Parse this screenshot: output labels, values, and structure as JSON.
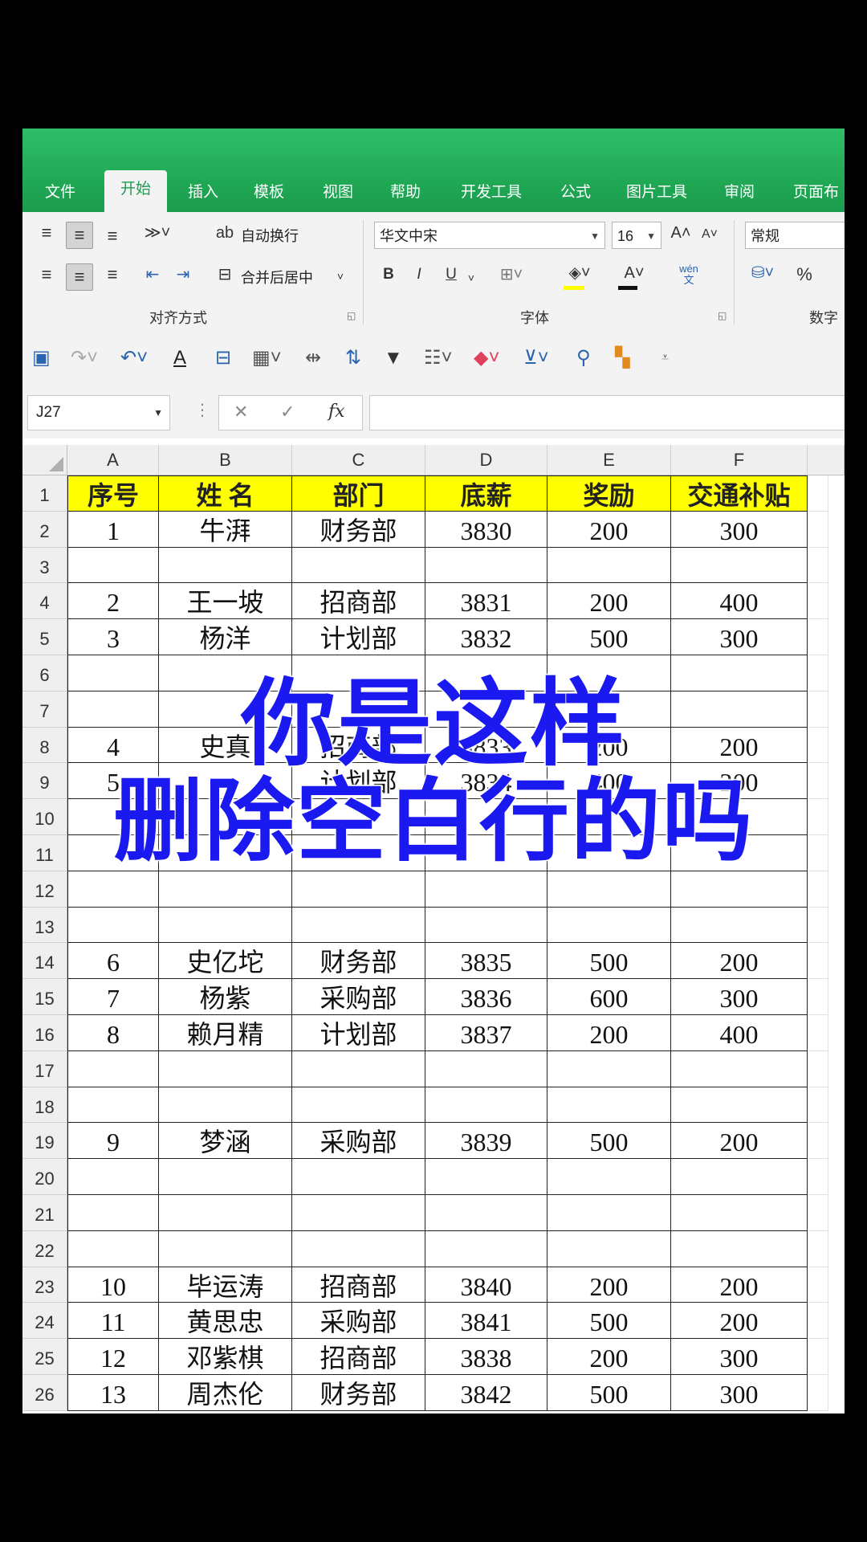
{
  "ribbon_tabs": [
    "文件",
    "开始",
    "插入",
    "模板",
    "视图",
    "帮助",
    "开发工具",
    "公式",
    "图片工具",
    "审阅",
    "页面布"
  ],
  "active_tab": "开始",
  "ribbon": {
    "wrap_text": "自动换行",
    "merge_center": "合并后居中",
    "align_group_label": "对齐方式",
    "font_name": "华文中宋",
    "font_size": "16",
    "font_group_label": "字体",
    "number_format": "常规",
    "number_group_label": "数字",
    "bold": "B",
    "italic": "I",
    "underline": "U",
    "percent": "%",
    "phonetic": "wén"
  },
  "name_box": "J27",
  "formula_value": "",
  "columns": [
    "A",
    "B",
    "C",
    "D",
    "E",
    "F"
  ],
  "header_row": [
    "序号",
    "姓  名",
    "部门",
    "底薪",
    "奖励",
    "交通补贴"
  ],
  "rows": [
    {
      "num": "1",
      "cells": [
        "序号",
        "姓  名",
        "部门",
        "底薪",
        "奖励",
        "交通补贴"
      ]
    },
    {
      "num": "2",
      "cells": [
        "1",
        "牛湃",
        "财务部",
        "3830",
        "200",
        "300"
      ]
    },
    {
      "num": "3",
      "cells": [
        "",
        "",
        "",
        "",
        "",
        ""
      ]
    },
    {
      "num": "4",
      "cells": [
        "2",
        "王一坡",
        "招商部",
        "3831",
        "200",
        "400"
      ]
    },
    {
      "num": "5",
      "cells": [
        "3",
        "杨洋",
        "计划部",
        "3832",
        "500",
        "300"
      ]
    },
    {
      "num": "6",
      "cells": [
        "",
        "",
        "",
        "",
        "",
        ""
      ]
    },
    {
      "num": "7",
      "cells": [
        "",
        "",
        "",
        "",
        "",
        ""
      ]
    },
    {
      "num": "8",
      "cells": [
        "4",
        "史真",
        "招商部",
        "3833",
        "200",
        "200"
      ]
    },
    {
      "num": "9",
      "cells": [
        "5",
        "",
        "计划部",
        "3834",
        "400",
        "200"
      ]
    },
    {
      "num": "10",
      "cells": [
        "",
        "",
        "",
        "",
        "",
        ""
      ]
    },
    {
      "num": "11",
      "cells": [
        "",
        "",
        "",
        "",
        "",
        ""
      ]
    },
    {
      "num": "12",
      "cells": [
        "",
        "",
        "",
        "",
        "",
        ""
      ]
    },
    {
      "num": "13",
      "cells": [
        "",
        "",
        "",
        "",
        "",
        ""
      ]
    },
    {
      "num": "14",
      "cells": [
        "6",
        "史亿坨",
        "财务部",
        "3835",
        "500",
        "200"
      ]
    },
    {
      "num": "15",
      "cells": [
        "7",
        "杨紫",
        "采购部",
        "3836",
        "600",
        "300"
      ]
    },
    {
      "num": "16",
      "cells": [
        "8",
        "赖月精",
        "计划部",
        "3837",
        "200",
        "400"
      ]
    },
    {
      "num": "17",
      "cells": [
        "",
        "",
        "",
        "",
        "",
        ""
      ]
    },
    {
      "num": "18",
      "cells": [
        "",
        "",
        "",
        "",
        "",
        ""
      ]
    },
    {
      "num": "19",
      "cells": [
        "9",
        "梦涵",
        "采购部",
        "3839",
        "500",
        "200"
      ]
    },
    {
      "num": "20",
      "cells": [
        "",
        "",
        "",
        "",
        "",
        ""
      ]
    },
    {
      "num": "21",
      "cells": [
        "",
        "",
        "",
        "",
        "",
        ""
      ]
    },
    {
      "num": "22",
      "cells": [
        "",
        "",
        "",
        "",
        "",
        ""
      ]
    },
    {
      "num": "23",
      "cells": [
        "10",
        "毕运涛",
        "招商部",
        "3840",
        "200",
        "200"
      ]
    },
    {
      "num": "24",
      "cells": [
        "11",
        "黄思忠",
        "采购部",
        "3841",
        "500",
        "200"
      ]
    },
    {
      "num": "25",
      "cells": [
        "12",
        "邓紫棋",
        "招商部",
        "3838",
        "200",
        "300"
      ]
    },
    {
      "num": "26",
      "cells": [
        "13",
        "周杰伦",
        "财务部",
        "3842",
        "500",
        "300"
      ]
    }
  ],
  "caption_line1": "你是这样",
  "caption_line2": "删除空白行的吗",
  "colors": {
    "ribbon_green": "#1fa653",
    "header_fill": "#ffff00",
    "caption": "#1a1af0"
  }
}
